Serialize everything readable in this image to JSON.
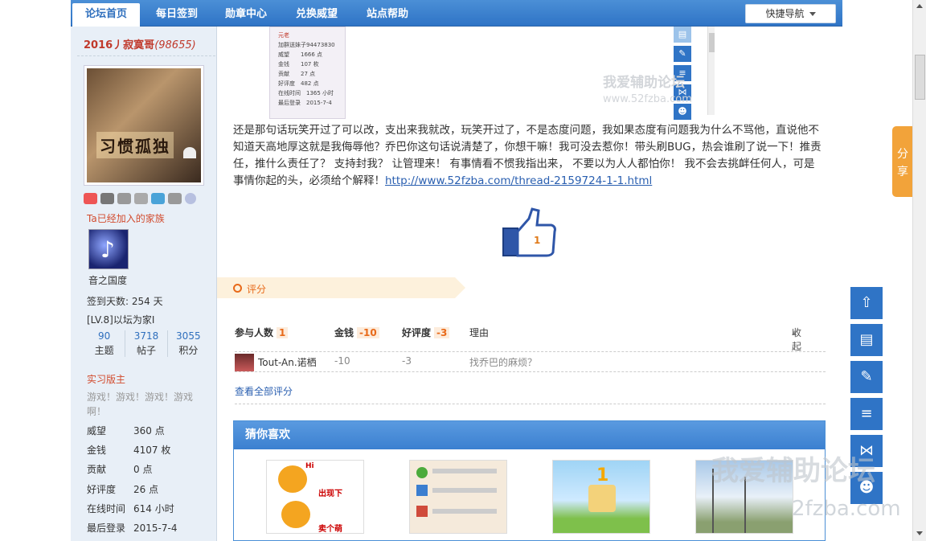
{
  "nav": {
    "tabs": [
      "论坛首页",
      "每日签到",
      "勋章中心",
      "兑换威望",
      "站点帮助"
    ],
    "quick_nav": "快捷导航"
  },
  "user": {
    "name": "2016丿寂寞哥",
    "uid": "(98655)",
    "avatar_text": "习惯孤独",
    "family_link": "Ta已经加入的家族",
    "family_name": "音之国度",
    "checkin_days": "签到天数: 254 天",
    "level": "[LV.8]以坛为家I",
    "stats": [
      {
        "num": "90",
        "label": "主题"
      },
      {
        "num": "3718",
        "label": "帖子"
      },
      {
        "num": "3055",
        "label": "积分"
      }
    ],
    "rank": "实习版主",
    "signature": "游戏！游戏！游戏！游戏啊！",
    "details": [
      {
        "k": "威望",
        "v": "360 点"
      },
      {
        "k": "金钱",
        "v": "4107 枚"
      },
      {
        "k": "贡献",
        "v": "0 点"
      },
      {
        "k": "好评度",
        "v": "26 点"
      },
      {
        "k": "在线时间",
        "v": "614 小时"
      },
      {
        "k": "最后登录",
        "v": "2015-7-4"
      }
    ]
  },
  "embedded_profile": {
    "lines": [
      "元老",
      "加群送妹子94473830",
      "威望　　1666 点",
      "金钱　　107 枚",
      "贡献　　27 点",
      "好评度　482 点",
      "在线时间　1365 小时",
      "最后登录　2015-7-4"
    ]
  },
  "watermark": {
    "site_name": "我爱辅助论坛",
    "url": "www.52fzba.com",
    "url_partial": "2fzba.com"
  },
  "post": {
    "text": "还是那句话玩笑开过了可以改，支出来我就改，玩笑开过了，不是态度问题，我如果态度有问题我为什么不骂他，直说他不知道天高地厚这就是我侮辱他？乔巴你这句话说清楚了，你想干嘛！我可没去惹你！带头刷BUG，热会谁刷了说一下！推责任，推什么责任了？ 支持封我？ 让管理来！ 有事情看不惯我指出来，  不要以为人人都怕你！ 我不会去挑衅任何人，可是事情你起的头，必须给个解释！",
    "link": "http://www.52fzba.com/thread-2159724-1-1.html",
    "like_count": "1"
  },
  "rating": {
    "section_label": "评分",
    "headers": {
      "participants": "参与人数",
      "participants_count": "1",
      "gold": "金钱",
      "gold_value": "-10",
      "rep": "好评度",
      "rep_value": "-3",
      "reason": "理由",
      "collapse": "收起"
    },
    "rows": [
      {
        "user": "Tout-An.诺栖",
        "gold": "-10",
        "rep": "-3",
        "reason": "找乔巴的麻烦？"
      }
    ],
    "view_all": "查看全部评分"
  },
  "recommend": {
    "title": "猜你喜欢",
    "item1_texts": [
      "Hi",
      "出现下",
      "卖个萌"
    ]
  },
  "side_tools": {
    "share": "分享"
  }
}
